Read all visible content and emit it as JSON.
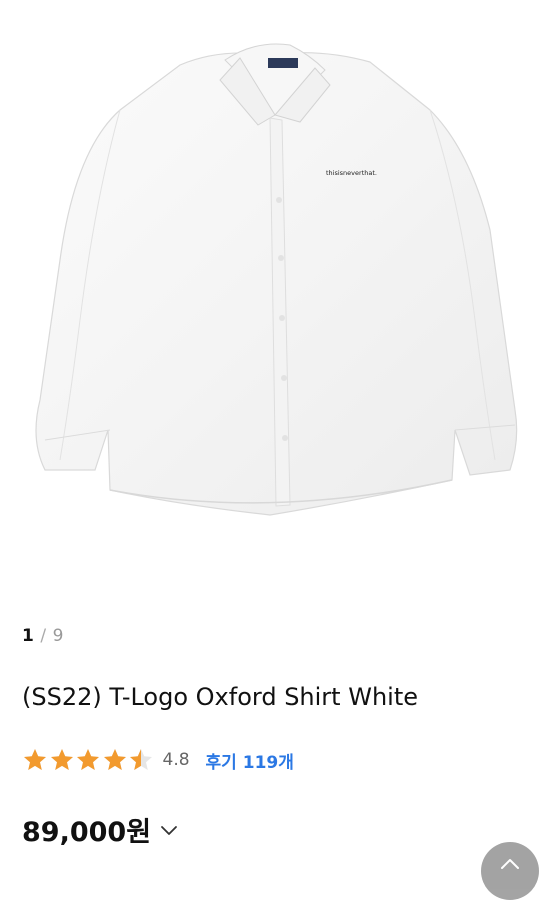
{
  "image": {
    "alt_icon": "shirt-image",
    "gallery": {
      "current": "1",
      "separator": "/",
      "total": "9"
    },
    "logo_text": "thisisneverthat."
  },
  "product": {
    "title": "(SS22) T-Logo Oxford Shirt White",
    "rating": {
      "value": "4.8",
      "stars_filled": 4.5,
      "stars_total": 5,
      "color": "#f29a2e"
    },
    "reviews_label": "후기 119개",
    "price": "89,000원",
    "price_toggle_icon": "chevron-down-icon"
  },
  "colors": {
    "link": "#2b78e4",
    "star": "#f29a2e",
    "fab": "#9a9a9a"
  },
  "fab": {
    "icon": "chevron-up-icon"
  }
}
